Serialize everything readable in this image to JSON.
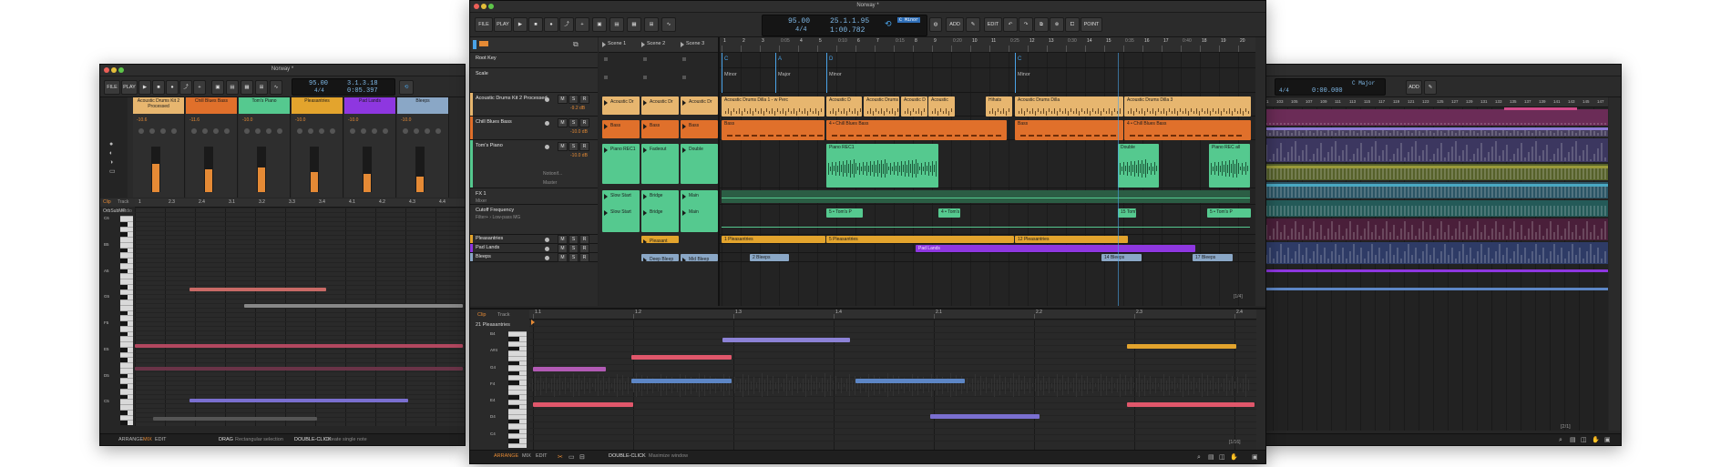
{
  "center": {
    "title": "Norway *",
    "toolbar": {
      "file": "FILE",
      "play": "PLAY",
      "add": "ADD",
      "edit": "EDIT",
      "point": "POINT",
      "tempo": "95.00",
      "time_sig": "4/4",
      "position": "25.1.1.95",
      "time": "1:00.782",
      "key": "C Minor"
    },
    "scene_labels": [
      "Scene 1",
      "Scene 2",
      "Scene 3"
    ],
    "ruler_labels": [
      "1",
      "2",
      "3",
      "0:05",
      "4",
      "5",
      "0:10",
      "6",
      "7",
      "0:15",
      "8",
      "9",
      "0:20",
      "10",
      "11",
      "0:25",
      "12",
      "13",
      "0:30",
      "14",
      "15",
      "0:35",
      "16",
      "17",
      "0:40",
      "18",
      "19",
      "20"
    ],
    "tracks": [
      {
        "name": "Root Key",
        "sub": ""
      },
      {
        "name": "Scale",
        "sub": ""
      },
      {
        "name": "Acoustic Drums Kit 2 Processed",
        "sub": "",
        "vol": "-9.2 dB"
      },
      {
        "name": "Chill Blues Bass",
        "sub": "",
        "vol": "-10.0 dB"
      },
      {
        "name": "Tom's Piano",
        "sub": "",
        "vol": "-10.0 dB",
        "extra": [
          "Notionif...",
          "Master"
        ]
      },
      {
        "name": "FX 1",
        "sub": "Mixer"
      },
      {
        "name": "Cutoff Frequency",
        "sub": "Filter+ › Low-pass MG"
      },
      {
        "name": "Pleasantries",
        "sub": ""
      },
      {
        "name": "Pad Lands",
        "sub": ""
      },
      {
        "name": "Bleeps",
        "sub": ""
      }
    ],
    "msr": {
      "m": "M",
      "s": "S",
      "r": "R"
    },
    "root_key_markers": [
      "C",
      "A",
      "D",
      "C"
    ],
    "scale_markers": [
      "Minor",
      "Major",
      "Minor",
      "Minor"
    ],
    "launcher": {
      "drums": [
        "Acoustic Dr",
        "Acoustic Dr",
        "Acoustic Dr"
      ],
      "bass": [
        "Bass",
        "Bass",
        "Bass"
      ],
      "piano": [
        "Piano REC1",
        "Fadeout",
        "Double"
      ],
      "fx": [
        "Slow Start",
        "Bridge",
        "Main"
      ],
      "cutoff": [
        "Slow Start",
        "Bridge",
        "Main"
      ],
      "pleasantries": [
        "Pleasant"
      ],
      "bleeps": [
        "Deep Bleep",
        "Mid Bleep"
      ]
    },
    "arr_clips": {
      "drums": [
        "Acoustic Drums Dilla 1 - w Perc",
        "Acoustic D",
        "Acoustic Drums Dilla 1 - w Perc",
        "Acoustic D",
        "Acoustic",
        "Hihats",
        "Acoustic Drums Dilla",
        "Acoustic Drums Dilla 3"
      ],
      "bass": [
        "Bass",
        "4 • Chill Blues Bass",
        "Bass",
        "4 • Chill Blues Bass"
      ],
      "piano": [
        "Piano REC1",
        "Double",
        "Piano REC all"
      ],
      "cutoff": [
        "5 • Tom's P",
        "4 • Tom's",
        "15 Tom's P",
        "5 • Tom's P"
      ],
      "pleasantries": [
        "1 Pleasantries",
        "5 Pleasantries",
        "12 Pleasantries"
      ],
      "pad": [
        "Pad Lands"
      ],
      "bleeps": [
        "2 Bleeps",
        "14 Bleeps",
        "17 Bleeps"
      ]
    },
    "page_counter": "[1/4]",
    "editor": {
      "tab_clip": "Clip",
      "tab_track": "Track",
      "clip_name": "21  Pleasantries",
      "ruler": [
        "1.1",
        "1.2",
        "1.3",
        "1.4",
        "2.1",
        "2.2",
        "2.3",
        "2.4"
      ],
      "keys": [
        "B4",
        "A#4",
        "G4",
        "F4",
        "E4",
        "D4",
        "C4"
      ],
      "page_counter": "[1/16]"
    },
    "status": {
      "arrange": "ARRANGE",
      "mix": "MIX",
      "edit": "EDIT",
      "hint_key": "DOUBLE-CLICK",
      "hint": "Maximize window"
    }
  },
  "left": {
    "title": "Norway *",
    "toolbar": {
      "file": "FILE",
      "play": "PLAY",
      "tempo": "95.00",
      "time_sig": "4/4",
      "position": "3.1.3.18",
      "time": "0:05.397"
    },
    "mixer_channels": [
      {
        "name": "Acoustic Drums Kit 2 Processed",
        "color": "#e7b66f",
        "level": 0.62
      },
      {
        "name": "Chill Blues Bass",
        "color": "#e0702b",
        "level": 0.5
      },
      {
        "name": "Tom's Piano",
        "color": "#55c98f",
        "level": 0.55
      },
      {
        "name": "Pleasantries",
        "color": "#e3a42d",
        "level": 0.45
      },
      {
        "name": "Pad Lands",
        "color": "#8e37e0",
        "level": 0.4
      },
      {
        "name": "Bleeps",
        "color": "#8aa7c6",
        "level": 0.35
      }
    ],
    "mixer_values": [
      "-10.6",
      "-11.6",
      "-10.0",
      "-10.0",
      "-10.0",
      "-10.0"
    ],
    "ruler": [
      "1",
      "2.3",
      "2.4",
      "3.1",
      "3.2",
      "3.3",
      "3.4",
      "4.1",
      "4.2",
      "4.3",
      "4.4"
    ],
    "tab_clip": "Clip",
    "tab_track": "Track",
    "clip_name": "OrbSubMP",
    "clip_sub": "Audio",
    "keys": [
      "C6",
      "B5",
      "A5",
      "G5",
      "F5",
      "E5",
      "D5",
      "C5"
    ],
    "status": {
      "arrange": "ARRANGE",
      "mix": "MIX",
      "edit": "EDIT",
      "hint_key1": "DRAG",
      "hint1": "Rectangular selection",
      "hint_key2": "DOUBLE-CLICK",
      "hint2": "Create single note"
    }
  },
  "right": {
    "toolbar": {
      "time_sig": "4/4",
      "time": "0:00.000",
      "key": "C Major",
      "add": "ADD"
    },
    "ruler": [
      "101",
      "103",
      "105",
      "107",
      "109",
      "111",
      "113",
      "115",
      "117",
      "119",
      "121",
      "123",
      "125",
      "127",
      "129",
      "131",
      "133",
      "135",
      "137",
      "139",
      "141",
      "143",
      "145",
      "147",
      "149",
      "151",
      "153",
      "155",
      "157",
      "159",
      "161",
      "163",
      "165",
      "167",
      "169",
      "171",
      "173",
      "175",
      "177",
      "179",
      "181",
      "183",
      "185"
    ],
    "page_counter": "[2/1]"
  },
  "colors": {
    "drums": "#e7b66f",
    "bass": "#e0702b",
    "piano": "#55c98f",
    "pleasantries": "#e3a42d",
    "pad": "#8e37e0",
    "bleeps": "#8aa7c6",
    "accent": "#e58a35",
    "blue": "#4aa3e8"
  }
}
